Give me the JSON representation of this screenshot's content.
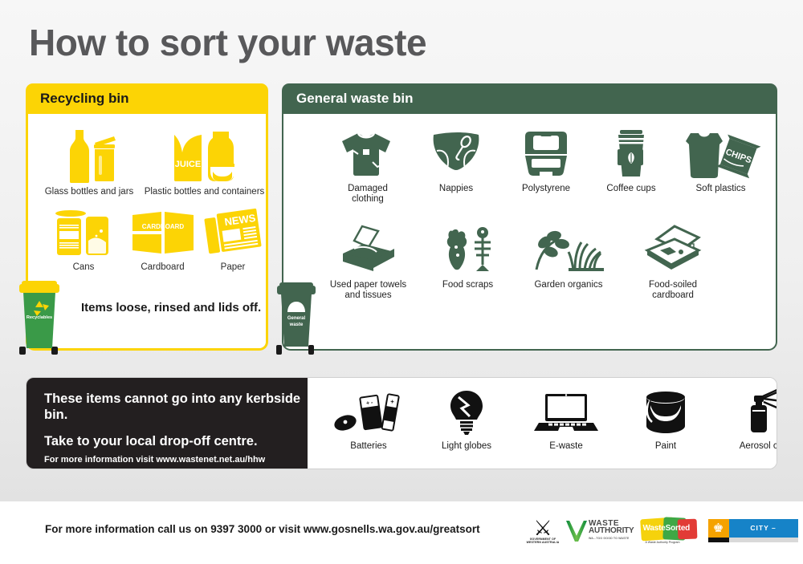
{
  "page": {
    "title": "How to sort your waste"
  },
  "colors": {
    "recycling_yellow": "#fcd405",
    "general_green": "#42654f",
    "black": "#231f20",
    "bin_green": "#3a9a48",
    "title_grey": "#58585a"
  },
  "recycling": {
    "header": "Recycling bin",
    "note": "Items loose, rinsed and lids off.",
    "bin_label": "Recyclables",
    "bin_icon": "recycle-arrows-icon",
    "items": [
      {
        "icon": "glass-bottle-and-jar-icon",
        "label": "Glass bottles and jars"
      },
      {
        "icon": "plastic-bottle-and-juice-carton-icon",
        "label": "Plastic bottles and containers",
        "art_text": "JUICE"
      },
      {
        "icon": "cans-icon",
        "label": "Cans"
      },
      {
        "icon": "cardboard-box-icon",
        "label": "Cardboard",
        "art_text": "CARDBOARD"
      },
      {
        "icon": "newspaper-icon",
        "label": "Paper",
        "art_text": "NEWS"
      }
    ]
  },
  "general": {
    "header": "General waste bin",
    "bin_label": "General\nwaste",
    "bin_icon": "dome-lid-icon",
    "items_row1": [
      {
        "icon": "damaged-clothing-icon",
        "label": "Damaged\nclothing"
      },
      {
        "icon": "nappies-icon",
        "label": "Nappies"
      },
      {
        "icon": "polystyrene-container-icon",
        "label": "Polystyrene"
      },
      {
        "icon": "coffee-cup-icon",
        "label": "Coffee cups"
      },
      {
        "icon": "soft-plastics-icon",
        "label": "Soft plastics",
        "art_text": "CHIPS"
      }
    ],
    "items_row2": [
      {
        "icon": "tissue-box-icon",
        "label": "Used paper towels\nand tissues"
      },
      {
        "icon": "food-scraps-icon",
        "label": "Food scraps"
      },
      {
        "icon": "garden-organics-icon",
        "label": "Garden organics"
      },
      {
        "icon": "food-soiled-pizza-box-icon",
        "label": "Food-soiled\ncardboard"
      }
    ]
  },
  "strip": {
    "line1": "These items cannot go into any kerbside bin.",
    "line2": "Take to your local drop-off centre.",
    "line3": "For more information visit www.wastenet.net.au/hhw",
    "items": [
      {
        "icon": "batteries-icon",
        "label": "Batteries"
      },
      {
        "icon": "light-globe-icon",
        "label": "Light globes"
      },
      {
        "icon": "laptop-ewaste-icon",
        "label": "E-waste"
      },
      {
        "icon": "paint-tin-icon",
        "label": "Paint"
      },
      {
        "icon": "aerosol-can-icon",
        "label": "Aerosol cans"
      }
    ]
  },
  "footer": {
    "text": "For more information call us on 9397 3000 or visit www.gosnells.wa.gov.au/greatsort",
    "logos": {
      "wa_gov": {
        "line1": "GOVERNMENT OF",
        "line2": "WESTERN AUSTRALIA",
        "icon": "wa-state-crest-icon"
      },
      "waste_authority": {
        "line1": "WASTE",
        "line2": "AUTHORITY",
        "tagline": "WA...TOO GOOD TO WASTE",
        "icon": "waste-authority-v-icon"
      },
      "waste_sorted": {
        "wordmark": "WasteSorted",
        "tagline": "A Waste Authority Program",
        "icon": "wastesorted-cards-icon"
      },
      "city_of_gosnells": {
        "wordmark": "CITY – GOSNELLS",
        "icon": "gosnells-crest-icon"
      }
    }
  }
}
